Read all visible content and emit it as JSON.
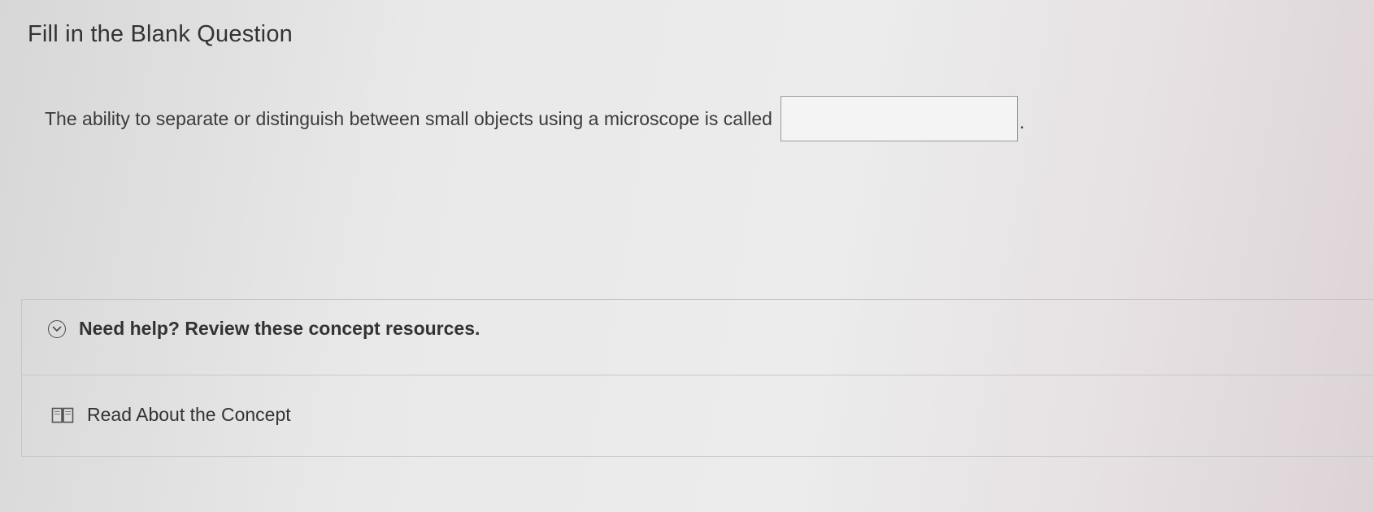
{
  "question": {
    "title": "Fill in the Blank Question",
    "prompt": "The ability to separate or distinguish between small objects using a microscope is called",
    "answer_value": "",
    "trailing_punctuation": "."
  },
  "resources": {
    "toggle_label": "Need help? Review these concept resources.",
    "toggle_icon": "chevron-down-circle-icon",
    "items": [
      {
        "label": "Read About the Concept",
        "icon": "book-icon"
      }
    ]
  }
}
